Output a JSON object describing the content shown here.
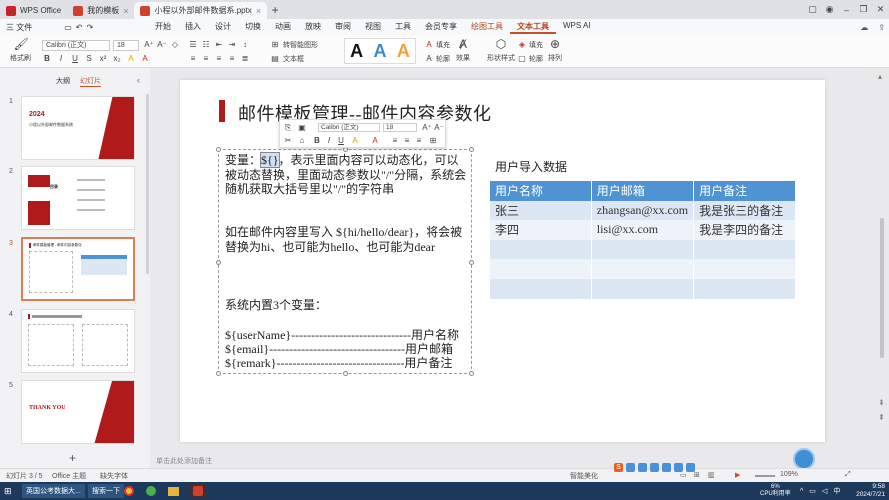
{
  "tabs": [
    {
      "label": "WPS Office",
      "color": "#c7232a",
      "active": false
    },
    {
      "label": "我的模板",
      "color": "#d0402c",
      "active": false
    },
    {
      "label": "小程以外部邮件数据系.pptx",
      "color": "#d0402c",
      "active": true
    }
  ],
  "menu": {
    "file": "三 文件",
    "items": [
      "开始",
      "插入",
      "设计",
      "切换",
      "动画",
      "放映",
      "审阅",
      "视图",
      "工具",
      "会员专享",
      "绘图工具",
      "文本工具",
      "WPS AI"
    ],
    "highlight_index": 10,
    "active_index": 11
  },
  "ribbon": {
    "format_painter": "格式刷",
    "font_name": "Calibri (正文)",
    "font_size": "18",
    "convert_shape": "转智能图形",
    "text_box": "文本框",
    "text_dir": "对齐文本",
    "effects": "效果",
    "text_fill": "填充",
    "outline": "轮廓",
    "shape_fill": "形状样式",
    "arrange": "排列",
    "style_letters": [
      "A",
      "A",
      "A"
    ]
  },
  "left_panel": {
    "tab_outline": "大纲",
    "tab_slides": "幻灯片",
    "slide_numbers": [
      "1",
      "2",
      "3",
      "4",
      "5"
    ],
    "slide1_year": "2024",
    "slide1_subtitle": "小程以外部邮件数据系统",
    "slide2_title": "目录",
    "slide3_title": "邮件模板管理 - 邮件内容参数化",
    "slide5_title": "THANK YOU"
  },
  "slide": {
    "title": "邮件模板管理--邮件内容参数化",
    "para1_a": "变量：",
    "para1_sel": "${}",
    "para1_b": "，表示里面内容可以动态化，可以被动态替换，里面动态参数以\"/\"分隔，系统会随机获取大括号里以\"/\"的字符串",
    "para2": "如在邮件内容里写入 ${hi/hello/dear}，将会被替换为hi、也可能为hello、也可能为dear",
    "para3": "系统内置3个变量：",
    "vars": [
      "${userName}------------------------------用户名称",
      "${email}----------------------------------用户邮箱",
      "${remark}--------------------------------用户备注"
    ],
    "table_title": "用户导入数据",
    "table_headers": [
      "用户名称",
      "用户邮箱",
      "用户备注"
    ],
    "table_rows": [
      [
        "张三",
        "zhangsan@xx.com",
        "我是张三的备注"
      ],
      [
        "李四",
        "lisi@xx.com",
        "我是李四的备注"
      ],
      [
        "",
        "",
        ""
      ],
      [
        "",
        "",
        ""
      ],
      [
        "",
        "",
        ""
      ]
    ]
  },
  "mini_toolbar": {
    "font_name": "Calibri (正文)",
    "font_size": "18"
  },
  "notes_placeholder": "单击此处添加备注",
  "status": {
    "slide_info": "幻灯片 3 / 5",
    "theme": "Office 主题",
    "missing_font": "缺失字体",
    "smart_beautify": "智能美化",
    "zoom": "109%"
  },
  "taskbar": {
    "app1": "英国公考数据大...",
    "app2": "搜索一下",
    "cpu": "6%",
    "cpu_label": "CPU利用率",
    "time": "9:58",
    "date": "2024/7/21"
  },
  "colors": {
    "accent": "#c2512a",
    "slide_red": "#b01a1a",
    "table_header": "#4f93d2"
  }
}
